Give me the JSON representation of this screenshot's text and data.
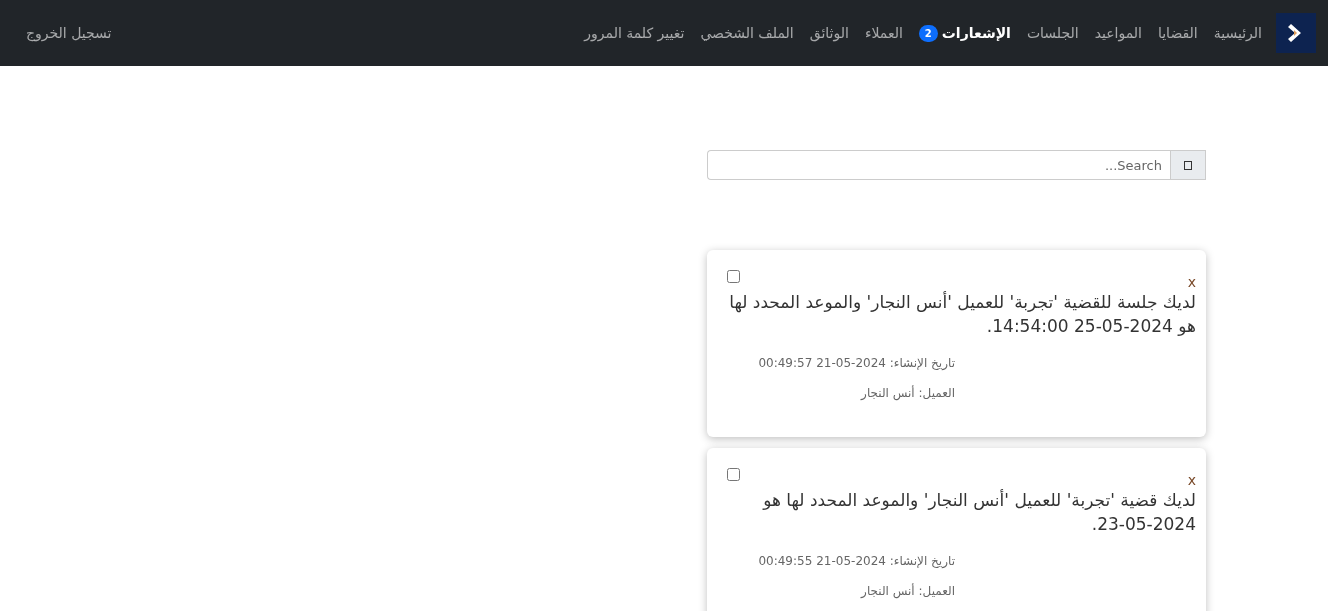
{
  "navbar": {
    "logo": {
      "kind": "brand"
    },
    "items": [
      {
        "label": "الرئيسية",
        "selected": false
      },
      {
        "label": "القضايا",
        "selected": false
      },
      {
        "label": "المواعيد",
        "selected": false
      },
      {
        "label": "الجلسات",
        "selected": false
      },
      {
        "label": "الإشعارات",
        "selected": true,
        "badge": "2"
      },
      {
        "label": "العملاء",
        "selected": false
      },
      {
        "label": "الوثائق",
        "selected": false
      },
      {
        "label": "الملف الشخصي",
        "selected": false
      },
      {
        "label": "تغيير كلمة المرور",
        "selected": false
      }
    ],
    "logout": "تسجيل الخروج"
  },
  "search": {
    "placeholder": "Search..."
  },
  "notifications": [
    {
      "checked": false,
      "close": "x",
      "message": "لديك جلسة للقضية 'تجربة' للعميل 'أنس النجار' والموعد المحدد لها هو 2024-05-25 14:54:00.",
      "created": "تاريخ الإنشاء: 2024-05-21 00:49:57",
      "client": "العميل: أنس النجار"
    },
    {
      "checked": false,
      "close": "x",
      "message": "لديك قضية 'تجربة' للعميل 'أنس النجار' والموعد المحدد لها هو 2024-05-23.",
      "created": "تاريخ الإنشاء: 2024-05-21 00:49:55",
      "client": "العميل: أنس النجار"
    }
  ]
}
